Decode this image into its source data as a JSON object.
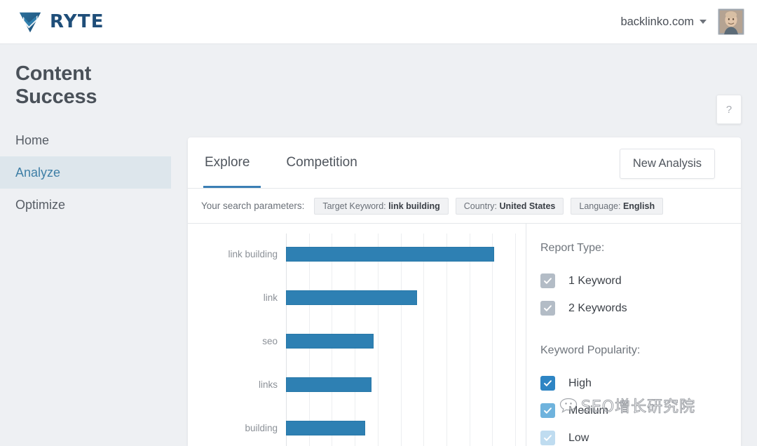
{
  "brand": {
    "name": "RYTE",
    "logo_icon": "diamond-check-logo",
    "color": "#1f4e79"
  },
  "topbar": {
    "domain": "backlinko.com",
    "caret_icon": "chevron-down-icon",
    "avatar_icon": "user-avatar"
  },
  "sidebar": {
    "title": "Content Success",
    "items": [
      {
        "label": "Home",
        "active": false
      },
      {
        "label": "Analyze",
        "active": true
      },
      {
        "label": "Optimize",
        "active": false
      }
    ]
  },
  "help": {
    "label": "?",
    "icon": "question-mark-icon"
  },
  "card": {
    "tabs": [
      {
        "label": "Explore",
        "active": true
      },
      {
        "label": "Competition",
        "active": false
      }
    ],
    "new_analysis_label": "New Analysis",
    "params_label": "Your search parameters:",
    "params": [
      {
        "key": "Target Keyword:",
        "value": "link building"
      },
      {
        "key": "Country:",
        "value": "United States"
      },
      {
        "key": "Language:",
        "value": "English"
      }
    ]
  },
  "options": {
    "report_type_heading": "Report Type:",
    "report_type": [
      {
        "label": "1 Keyword",
        "checked": true,
        "color": "#b3bcc6"
      },
      {
        "label": "2 Keywords",
        "checked": true,
        "color": "#b3bcc6"
      }
    ],
    "popularity_heading": "Keyword Popularity:",
    "popularity": [
      {
        "label": "High",
        "checked": true,
        "color": "#2e85c4"
      },
      {
        "label": "Medium",
        "checked": true,
        "color": "#6fb3dd"
      },
      {
        "label": "Low",
        "checked": true,
        "color": "#bfdcf0"
      }
    ]
  },
  "watermark": {
    "text": "SEO增长研究院",
    "icon": "speech-bubble-icon"
  },
  "chart_data": {
    "type": "bar",
    "orientation": "horizontal",
    "title": "",
    "xlabel": "",
    "ylabel": "",
    "categories": [
      "link building",
      "link",
      "seo",
      "links",
      "building"
    ],
    "values": [
      100,
      63,
      42,
      41,
      38
    ],
    "xlim": [
      0,
      110
    ],
    "grid": true,
    "gridline_count": 11,
    "bar_color": "#2e80b3",
    "legend": "none"
  }
}
